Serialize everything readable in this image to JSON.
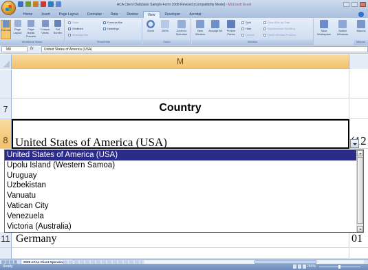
{
  "window": {
    "title_doc": "ACA Client Database Sample Form 2008 Revised  [Compatibility Mode] - ",
    "title_app": "Microsoft Excel"
  },
  "ribbon": {
    "tabs": [
      "Home",
      "Insert",
      "Page Layout",
      "Formulas",
      "Data",
      "Review",
      "View",
      "Developer",
      "Acrobat"
    ],
    "active_tab": "View",
    "workbook_views": {
      "label": "Workbook Views",
      "buttons": [
        "Normal",
        "Page Layout",
        "Page Break Preview",
        "Custom Views",
        "Full Screen"
      ]
    },
    "show_hide": {
      "label": "Show/Hide",
      "ruler": "Ruler",
      "gridlines": "Gridlines",
      "message_bar": "Message Bar",
      "formula_bar": "Formula Bar",
      "headings": "Headings"
    },
    "zoom": {
      "label": "Zoom",
      "buttons": [
        "Zoom",
        "100%",
        "Zoom to Selection"
      ]
    },
    "window": {
      "label": "Window",
      "buttons": [
        "New Window",
        "Arrange All",
        "Freeze Panes"
      ],
      "split": "Split",
      "hide": "Hide",
      "unhide": "Unhide",
      "view_side": "View Side by Side",
      "sync_scroll": "Synchronous Scrolling",
      "reset_pos": "Reset Window Position",
      "save_workspace": "Save Workspace",
      "switch_windows": "Switch Windows"
    },
    "macros": {
      "label": "Macros",
      "button": "Macros"
    }
  },
  "formula_bar": {
    "name_box": "M8",
    "fx": "fx",
    "value": "United States of America (USA)"
  },
  "grid": {
    "column": "M",
    "rows": [
      {
        "num": "7",
        "m": "Country",
        "n": ""
      },
      {
        "num": "8",
        "m": "United States of America (USA)",
        "n": "(12"
      },
      {
        "num": "11",
        "m": "Germany",
        "n": "01"
      }
    ]
  },
  "dropdown": {
    "selected_index": 0,
    "items": [
      "United States of America (USA)",
      "Upolu Island (Western Samoa)",
      "Uruguay",
      "Uzbekistan",
      "Vanuatu",
      "Vatican City",
      "Venezuela",
      "Victoria (Australia)"
    ]
  },
  "sheet_tabs": {
    "active": "2008 ACAs Client Operation List"
  },
  "status_bar": {
    "status": "Ready",
    "zoom": "250%"
  }
}
